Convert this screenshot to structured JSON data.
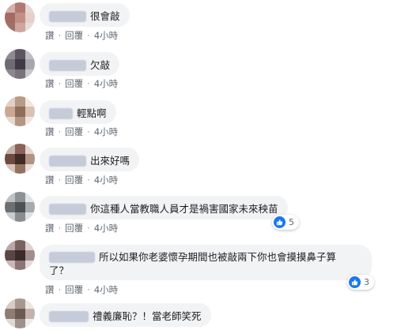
{
  "comments": [
    {
      "text": "很會敲",
      "actions": {
        "like": "讚",
        "reply": "回覆",
        "time": "4小時"
      },
      "avatar_colors": [
        "#d4b0aa",
        "#b07a72",
        "#e8d6d2",
        "#a36b63",
        "#c28f86",
        "#e6cfcb",
        "#9f7168",
        "#cfa69e",
        "#e9dbd8"
      ]
    },
    {
      "text": "欠敲",
      "actions": {
        "like": "讚",
        "reply": "回覆",
        "time": "4小時"
      },
      "avatar_colors": [
        "#8f8a92",
        "#5a5560",
        "#bfbcc2",
        "#6f6a73",
        "#3f3a45",
        "#a9a5ad",
        "#8b8690",
        "#77727c",
        "#c9c6cc"
      ]
    },
    {
      "text": "輕點啊",
      "actions": {
        "like": "讚",
        "reply": "回覆",
        "time": "4小時"
      },
      "avatar_colors": [
        "#e2d0c3",
        "#b89a86",
        "#f0e6df",
        "#c9a994",
        "#8e6d5a",
        "#d9c2b3",
        "#e7d8cd",
        "#b39683",
        "#efe5de"
      ]
    },
    {
      "text": "出來好嗎",
      "actions": {
        "like": "讚",
        "reply": "回覆",
        "time": "4小時"
      },
      "avatar_colors": [
        "#c9b3a8",
        "#8a6257",
        "#e3d4cd",
        "#6e4a40",
        "#3f2a24",
        "#b39283",
        "#d6c2b9",
        "#93725f",
        "#e9ded8"
      ]
    },
    {
      "text": "你這種人當教職人員才是禍害國家未來秧苗",
      "actions": {
        "like": "讚",
        "reply": "回覆",
        "time": "4小時"
      },
      "reactions": "5",
      "avatar_colors": [
        "#bfc1c3",
        "#8e9194",
        "#e2e3e4",
        "#6d7073",
        "#4e5154",
        "#a7aaad",
        "#c9cbcd",
        "#8a8d90",
        "#dfe0e1"
      ]
    },
    {
      "text_line1": "所以如果你老婆懷孕期間也被敲兩下你也會摸摸鼻子算",
      "text_line2": "了？",
      "actions": {
        "like": "讚",
        "reply": "回覆",
        "time": "4小時"
      },
      "reactions": "3",
      "avatar_colors": [
        "#b9a7a6",
        "#7a6261",
        "#dcd1d0",
        "#5b4645",
        "#3a2b2a",
        "#a18d8c",
        "#c8b8b7",
        "#8c7574",
        "#e2d9d8"
      ]
    },
    {
      "text": "禮義廉恥？！當老師笑死",
      "avatar_colors": [
        "#d6ccc8",
        "#a8978f",
        "#ece6e3",
        "#8f7d74",
        "#6b5a52",
        "#c2b4ad",
        "#e0d8d4",
        "#a0908a",
        "#efebe9"
      ]
    }
  ]
}
